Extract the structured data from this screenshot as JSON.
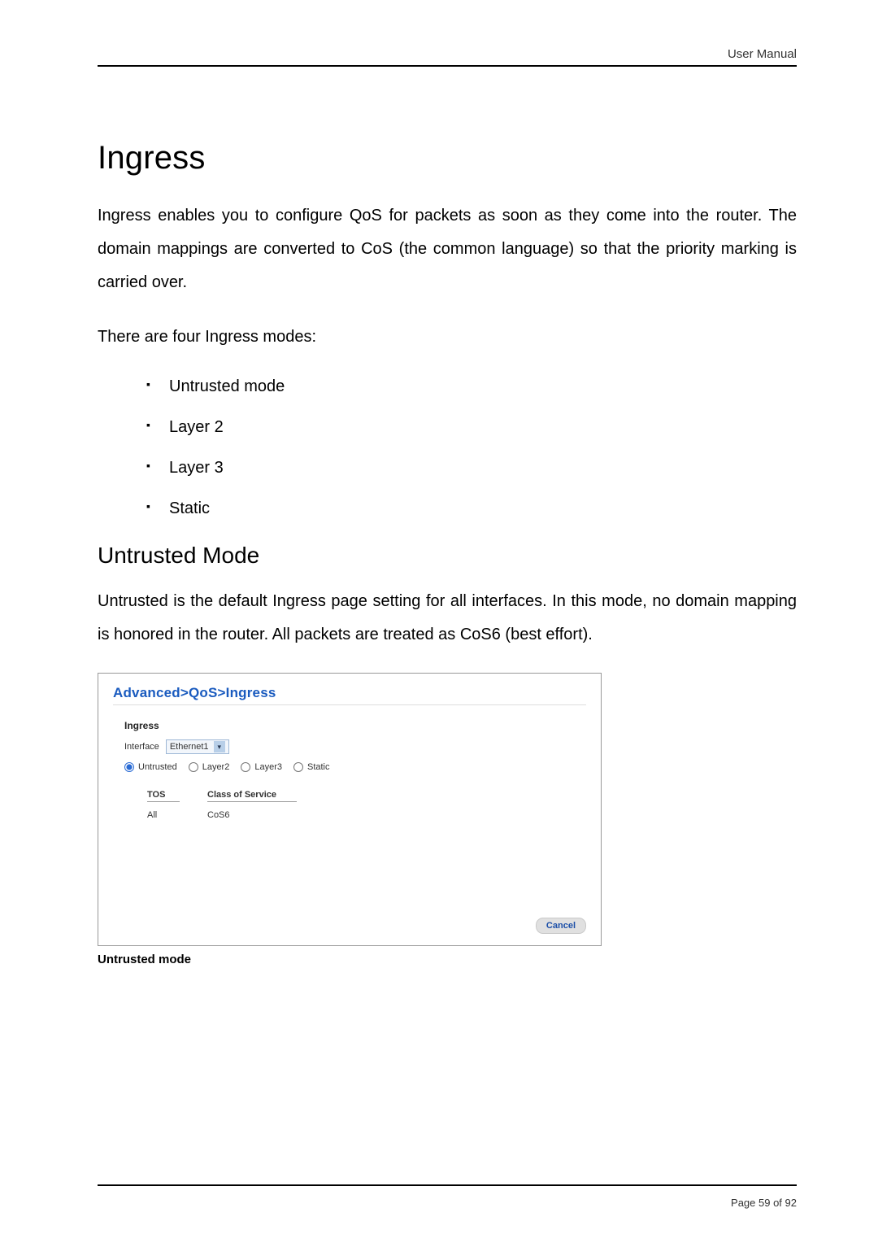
{
  "header": {
    "right": "User Manual"
  },
  "title": "Ingress",
  "para1": "Ingress enables you to configure QoS for packets as soon as they come into the router. The domain mappings are converted to CoS (the common language) so that the priority marking is carried over.",
  "para2": "There are four Ingress modes:",
  "modes": [
    "Untrusted mode",
    "Layer 2",
    "Layer 3",
    "Static"
  ],
  "section": {
    "heading": "Untrusted Mode",
    "para": "Untrusted is the default Ingress page setting for all interfaces. In this mode, no domain mapping is honored in the router. All packets are treated as CoS6 (best effort)."
  },
  "figure": {
    "breadcrumb": "Advanced>QoS>Ingress",
    "panel_title": "Ingress",
    "interface_label": "Interface",
    "interface_value": "Ethernet1",
    "radios": {
      "untrusted": "Untrusted",
      "layer2": "Layer2",
      "layer3": "Layer3",
      "static": "Static"
    },
    "table": {
      "head_tos": "TOS",
      "head_cos": "Class of Service",
      "row_tos": "All",
      "row_cos": "CoS6"
    },
    "cancel": "Cancel"
  },
  "caption": "Untrusted mode",
  "footer": "Page 59 of 92"
}
